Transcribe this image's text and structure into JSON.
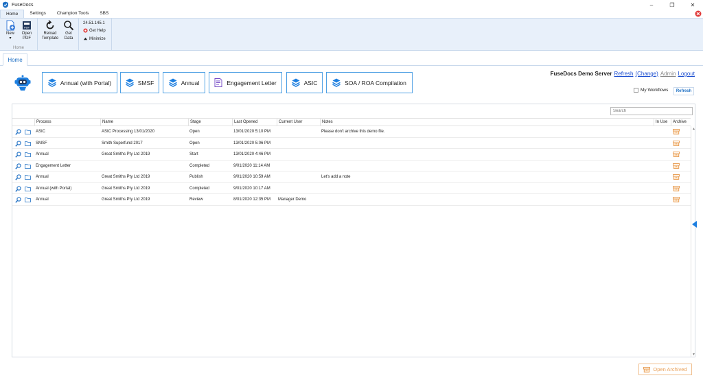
{
  "window": {
    "title": "FuseDocs",
    "icon": "fusedocs-shield-icon",
    "controls": [
      "minimize",
      "maximize",
      "close"
    ]
  },
  "ribbon_tabs": [
    {
      "label": "Home",
      "active": true
    },
    {
      "label": "Settings",
      "active": false
    },
    {
      "label": "Champion Tools",
      "active": false
    },
    {
      "label": "SBS",
      "active": false
    }
  ],
  "ribbon": {
    "new_label": "New",
    "new_sub": "▾",
    "open_pdf_label": "Open PDF",
    "group_home_label": "Home",
    "reload_label": "Reload Template",
    "get_data_label": "Get Data",
    "version": "24.51.145.1",
    "get_help_label": "Get Help",
    "minimize_label": "Minimize"
  },
  "page_tab": "Home",
  "workflow_buttons": [
    {
      "label": "Annual (with Portal)",
      "icon": "layers-icon"
    },
    {
      "label": "SMSF",
      "icon": "layers-icon"
    },
    {
      "label": "Annual",
      "icon": "layers-icon"
    },
    {
      "label": "Engagement Letter",
      "icon": "document-icon"
    },
    {
      "label": "ASIC",
      "icon": "layers-icon"
    },
    {
      "label": "SOA / ROA Compilation",
      "icon": "layers-icon"
    }
  ],
  "server": {
    "name": "FuseDocs Demo Server",
    "refresh": "Refresh",
    "change": "(Change)",
    "user": "Admin",
    "logout": "Logout"
  },
  "my_workflows_label": "My Workflows",
  "refresh_button": "Refresh",
  "search_placeholder": "Search",
  "columns": [
    "Process",
    "Name",
    "Stage",
    "Last Opened",
    "Current User",
    "Notes",
    "In Use",
    "Archive"
  ],
  "rows": [
    {
      "process": "ASIC",
      "name": "ASIC Processing 13/01/2020",
      "stage": "Open",
      "last_opened": "13/01/2020 5:10 PM",
      "current_user": "",
      "notes": "Please don't archive this demo file."
    },
    {
      "process": "SMSF",
      "name": "Smith Superfund 2017",
      "stage": "Open",
      "last_opened": "13/01/2020 5:06 PM",
      "current_user": "",
      "notes": ""
    },
    {
      "process": "Annual",
      "name": "Great Smiths Pty Ltd 2019",
      "stage": "Start",
      "last_opened": "13/01/2020 4:46 PM",
      "current_user": "",
      "notes": ""
    },
    {
      "process": "Engagement Letter",
      "name": "",
      "stage": "Completed",
      "last_opened": "9/01/2020 11:14 AM",
      "current_user": "",
      "notes": ""
    },
    {
      "process": "Annual",
      "name": "Great Smiths Pty Ltd 2019",
      "stage": "Publish",
      "last_opened": "9/01/2020 10:59 AM",
      "current_user": "",
      "notes": "Let's add a note"
    },
    {
      "process": "Annual (with Portal)",
      "name": "Great Smiths Pty Ltd 2019",
      "stage": "Completed",
      "last_opened": "9/01/2020 10:17 AM",
      "current_user": "",
      "notes": ""
    },
    {
      "process": "Annual",
      "name": "Great Smiths Pty Ltd 2019",
      "stage": "Review",
      "last_opened": "8/01/2020 12:35 PM",
      "current_user": "Manager Demo",
      "notes": ""
    }
  ],
  "open_archived_label": "Open Archived",
  "colors": {
    "accent": "#1d7fe0",
    "ribbon_bg": "#e8f0fa",
    "archive_orange": "#e9a15a",
    "link_blue": "#1d4fd0"
  }
}
